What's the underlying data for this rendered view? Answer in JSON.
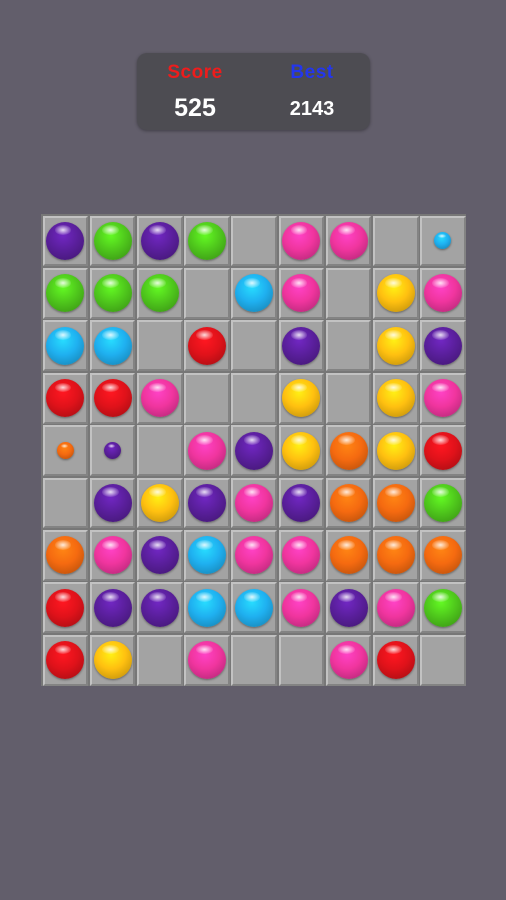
{
  "scoreboard": {
    "score_label": "Score",
    "score_value": "525",
    "best_label": "Best",
    "best_value": "2143"
  },
  "colors": {
    "purple": "#5a1f9c",
    "green": "#4fc81c",
    "pink": "#f0359e",
    "cyan": "#1fb0f0",
    "red": "#e0121a",
    "yellow": "#ffc010",
    "orange": "#f56a10"
  },
  "board": {
    "rows": [
      [
        "purple",
        "green",
        "purple",
        "green",
        null,
        "pink",
        "pink",
        null,
        "cyan:small"
      ],
      [
        "green",
        "green",
        "green",
        null,
        "cyan",
        "pink",
        null,
        "yellow",
        "pink"
      ],
      [
        "cyan",
        "cyan",
        null,
        "red",
        null,
        "purple",
        null,
        "yellow",
        "purple"
      ],
      [
        "red",
        "red",
        "pink",
        null,
        null,
        "yellow",
        null,
        "yellow",
        "pink"
      ],
      [
        "orange:small",
        "purple:small",
        null,
        "pink",
        "purple",
        "yellow",
        "orange",
        "yellow",
        "red"
      ],
      [
        null,
        "purple",
        "yellow",
        "purple",
        "pink",
        "purple",
        "orange",
        "orange",
        "green"
      ],
      [
        "orange",
        "pink",
        "purple",
        "cyan",
        "pink",
        "pink",
        "orange",
        "orange",
        "orange"
      ],
      [
        "red",
        "purple",
        "purple",
        "cyan",
        "cyan",
        "pink",
        "purple",
        "pink",
        "green"
      ],
      [
        "red",
        "yellow",
        null,
        "pink",
        null,
        null,
        "pink",
        "red",
        null
      ]
    ]
  }
}
